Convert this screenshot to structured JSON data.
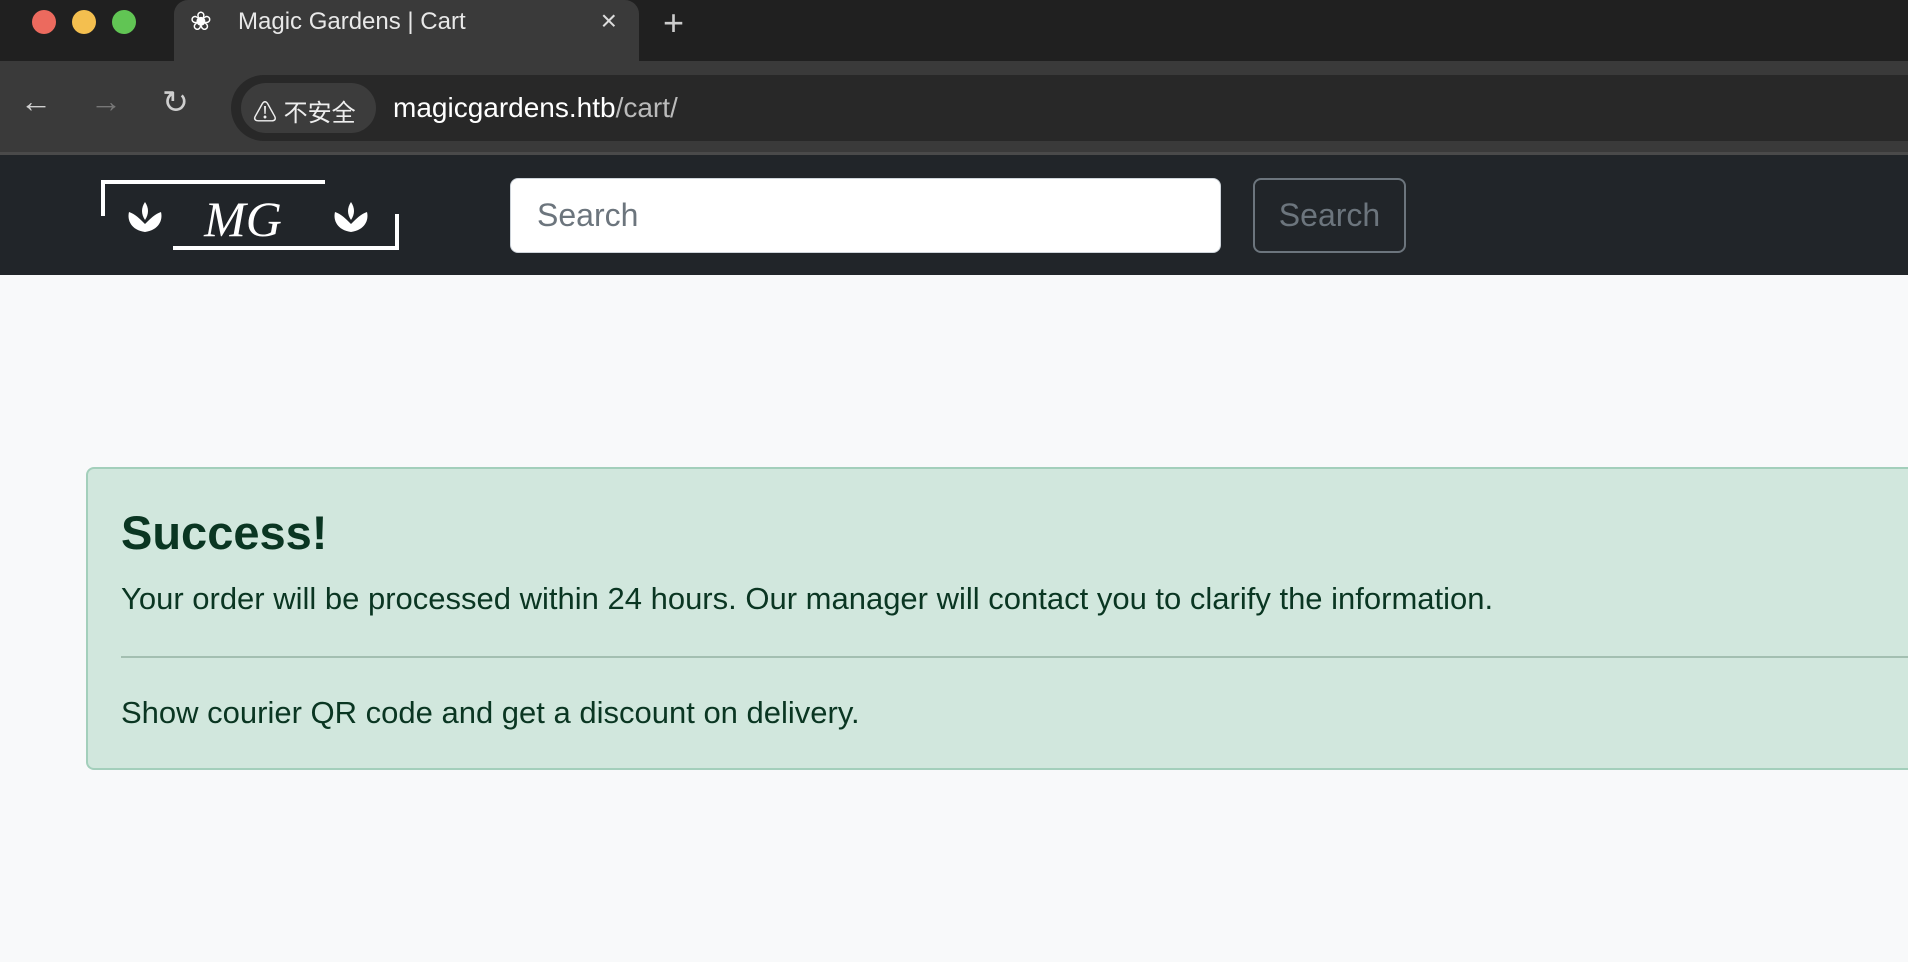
{
  "browser": {
    "tab_title": "Magic Gardens | Cart",
    "tab_close": "×",
    "new_tab": "+",
    "security_label": "不安全",
    "url_host": "magicgardens.htb",
    "url_path": "/cart/"
  },
  "navbar": {
    "logo_text": "MG",
    "search_placeholder": "Search",
    "search_button": "Search"
  },
  "alert": {
    "heading": "Success!",
    "message": "Your order will be processed within 24 hours. Our manager will contact you to clarify the information.",
    "note": "Show courier QR code and get a discount on delivery."
  },
  "colors": {
    "alert_bg": "#d1e7dd",
    "alert_text": "#0a3622",
    "navbar_bg": "#212529"
  }
}
